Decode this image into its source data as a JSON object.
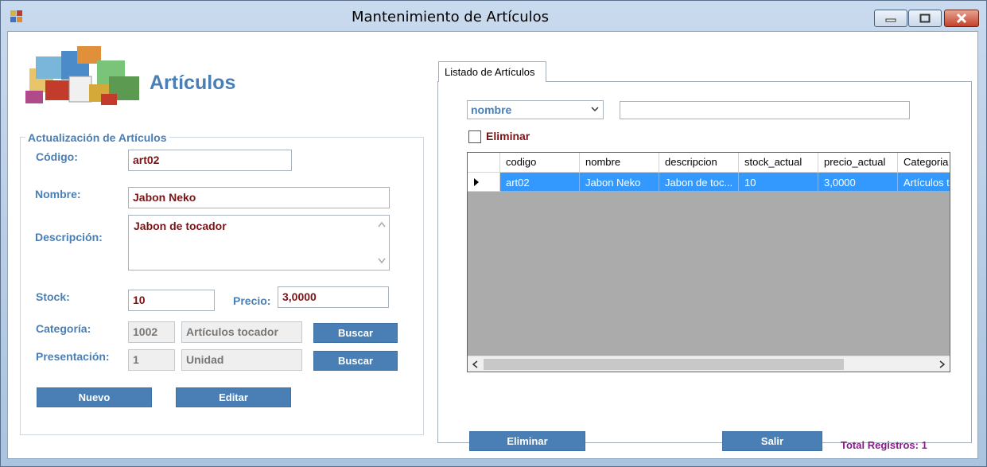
{
  "window": {
    "title": "Mantenimiento de Artículos"
  },
  "header": {
    "title": "Artículos"
  },
  "form": {
    "legend": "Actualización de Artículos",
    "codigo_label": "Código:",
    "codigo_value": "art02",
    "nombre_label": "Nombre:",
    "nombre_value": "Jabon Neko",
    "descripcion_label": "Descripción:",
    "descripcion_value": "Jabon de tocador",
    "stock_label": "Stock:",
    "stock_value": "10",
    "precio_label": "Precio:",
    "precio_value": "3,0000",
    "categoria_label": "Categoría:",
    "categoria_id": "1002",
    "categoria_name": "Artículos tocador",
    "presentacion_label": "Presentación:",
    "presentacion_id": "1",
    "presentacion_name": "Unidad",
    "buscar_label": "Buscar",
    "nuevo_label": "Nuevo",
    "editar_label": "Editar"
  },
  "listado": {
    "tab_label": "Listado de Artículos",
    "filter_selected": "nombre",
    "search_value": "",
    "eliminar_check_label": "Eliminar",
    "columns": [
      "codigo",
      "nombre",
      "descripcion",
      "stock_actual",
      "precio_actual",
      "Categoria"
    ],
    "rows": [
      [
        "art02",
        "Jabon Neko",
        "Jabon de toc...",
        "10",
        "3,0000",
        "Artículos t"
      ]
    ],
    "eliminar_button": "Eliminar",
    "salir_button": "Salir",
    "total_label": "Total Registros: 1"
  },
  "colors": {
    "accent": "#4a7fb5",
    "value_text": "#7b1416",
    "selection": "#3399ff",
    "total": "#8b1a8b"
  },
  "icons": [
    "app-icon",
    "minimize-icon",
    "maximize-icon",
    "close-icon",
    "chevron-down-icon",
    "scroll-up-icon",
    "scroll-down-icon",
    "scroll-left-icon",
    "scroll-right-icon",
    "row-pointer-icon"
  ]
}
